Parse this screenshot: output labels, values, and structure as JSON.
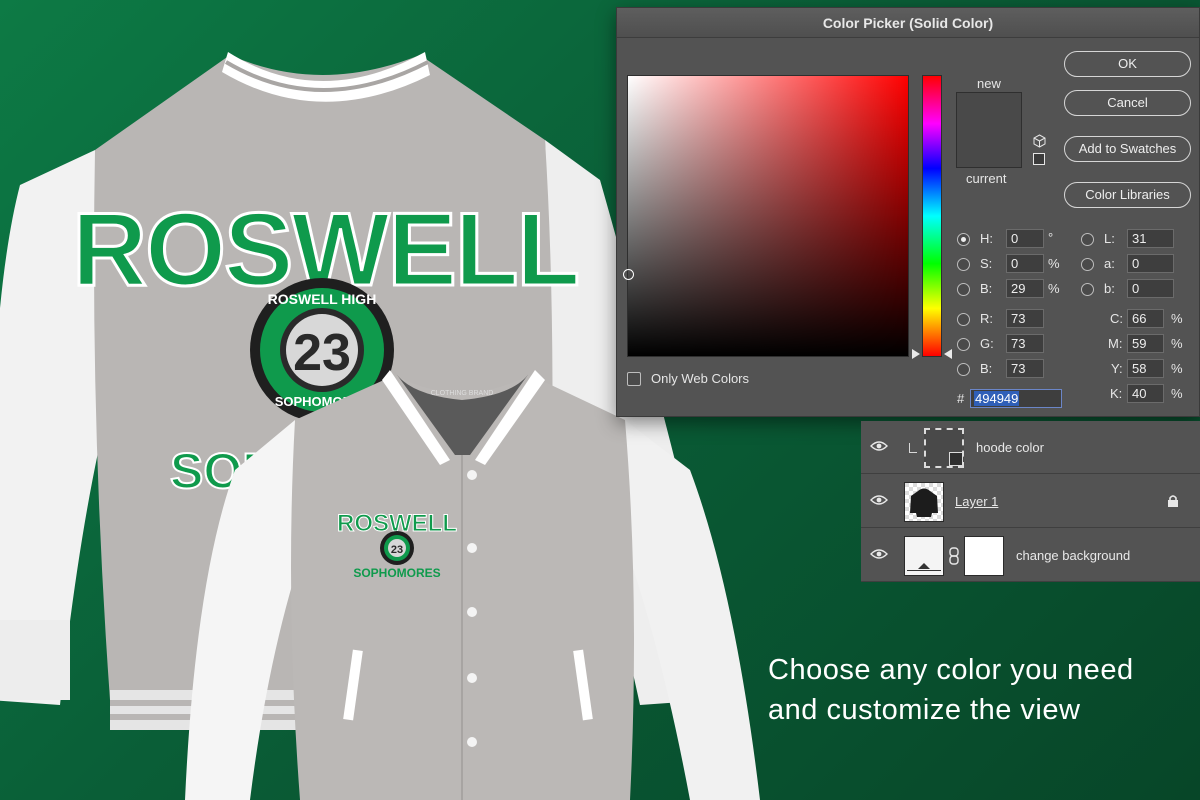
{
  "colors": {
    "background": "#0b6a3d",
    "jacket_body": "#b7b4b2",
    "jacket_sleeve": "#f4f4f4",
    "brand_green": "#0f9a4c",
    "current_color": "#494949"
  },
  "jacket_back": {
    "arch_text": "ROSWELL",
    "badge_top": "ROSWELL HIGH",
    "badge_number": "23",
    "badge_bottom": "SOPHOMORES",
    "lower_text": "SOPH"
  },
  "jacket_front": {
    "arch_text": "ROSWELL",
    "badge_number": "23",
    "lower_text": "SOPHOMORES",
    "collar_label": "CLOTHING BRAND"
  },
  "color_picker": {
    "title": "Color Picker (Solid Color)",
    "new_label": "new",
    "current_label": "current",
    "buttons": {
      "ok": "OK",
      "cancel": "Cancel",
      "add_to_swatches": "Add to Swatches",
      "color_libraries": "Color Libraries"
    },
    "only_web_colors": "Only Web Colors",
    "hsb": {
      "h_label": "H:",
      "h": "0",
      "h_unit": "°",
      "s_label": "S:",
      "s": "0",
      "s_unit": "%",
      "b_label": "B:",
      "b": "29",
      "b_unit": "%"
    },
    "rgb": {
      "r_label": "R:",
      "r": "73",
      "g_label": "G:",
      "g": "73",
      "b_label": "B:",
      "b": "73"
    },
    "lab": {
      "l_label": "L:",
      "l": "31",
      "a_label": "a:",
      "a": "0",
      "b_label": "b:",
      "b": "0"
    },
    "cmyk": {
      "c_label": "C:",
      "c": "66",
      "m_label": "M:",
      "m": "59",
      "y_label": "Y:",
      "y": "58",
      "k_label": "K:",
      "k": "40",
      "unit": "%"
    },
    "hex_label": "#",
    "hex": "494949"
  },
  "layers": [
    {
      "name": "hoode color",
      "icon": "eye-icon"
    },
    {
      "name": "Layer 1",
      "icon": "eye-icon",
      "locked": true
    },
    {
      "name": "change background",
      "icon": "eye-icon"
    }
  ],
  "tagline": {
    "line1": "Choose any color you need",
    "line2": "and customize the view"
  }
}
